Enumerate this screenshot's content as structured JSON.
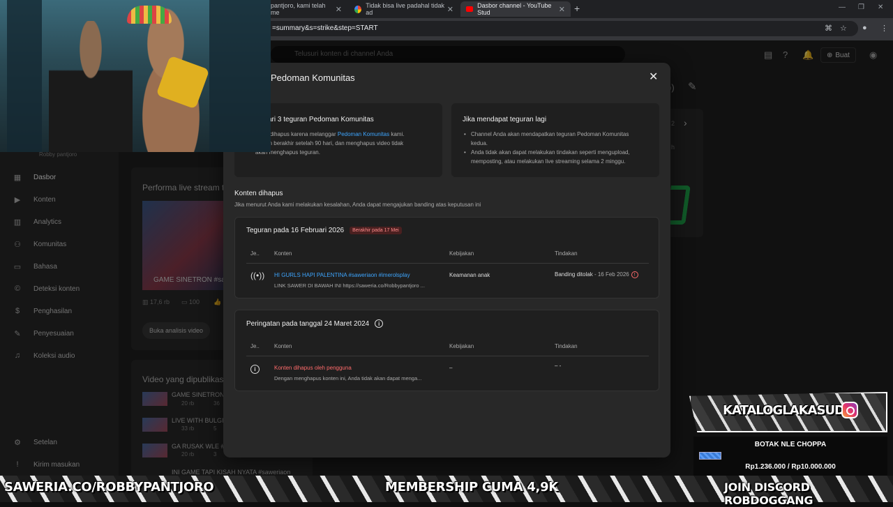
{
  "browser": {
    "tabs": [
      {
        "label": "pantjoro, kami telah me",
        "active": false
      },
      {
        "label": "Tidak bisa live padahal tidak ad",
        "active": false
      },
      {
        "label": "Dasbor channel - YouTube Stud",
        "active": true
      }
    ],
    "url": "=summary&s=strike&step=START"
  },
  "studio": {
    "search_placeholder": "Telusuri konten di channel Anda",
    "create_label": "Buat",
    "channel_name": "Robby pantjoro",
    "nav": [
      {
        "label": "Dasbor",
        "icon": "dashboard-icon",
        "active": true
      },
      {
        "label": "Konten",
        "icon": "content-icon"
      },
      {
        "label": "Analytics",
        "icon": "analytics-icon"
      },
      {
        "label": "Komunitas",
        "icon": "community-icon"
      },
      {
        "label": "Bahasa",
        "icon": "subtitles-icon"
      },
      {
        "label": "Deteksi konten",
        "icon": "copyright-icon"
      },
      {
        "label": "Penghasilan",
        "icon": "monetization-icon"
      },
      {
        "label": "Penyesuaian",
        "icon": "customization-icon"
      },
      {
        "label": "Koleksi audio",
        "icon": "audio-library-icon"
      }
    ],
    "nav_bottom": [
      {
        "label": "Setelan",
        "icon": "settings-icon"
      },
      {
        "label": "Kirim masukan",
        "icon": "feedback-icon"
      }
    ],
    "bg": {
      "live_perf_title": "Performa live stream t",
      "live_thumb_caption": "GAME SINETRON #sav",
      "stat_views": "17,6 rb",
      "stat_comments": "100",
      "analysis_button": "Buka analisis video",
      "published_title": "Video yang dipublikas",
      "published": [
        {
          "title": "GAME SINETRON #",
          "views": "20 rb",
          "extra": "36"
        },
        {
          "title": "LIVE WITH BULGIL",
          "views": "33 rb",
          "extra": "5"
        },
        {
          "title": "GA RUSAK WLE #sa",
          "views": "20 rb",
          "extra": "3"
        },
        {
          "title": "INI GAME TAPI KISAH NYATA #saweriaon",
          "views": "",
          "extra": ""
        }
      ],
      "pager": "2",
      "side_snip": "h"
    }
  },
  "modal": {
    "title": "Pedoman Komunitas",
    "card_left": {
      "title": "ari 3 teguran Pedoman Komunitas",
      "body_1": " Anda dihapus karena melanggar ",
      "body_link": "Pedoman Komunitas",
      "body_2": " kami.",
      "body_3": "n akan berakhir setelah 90 hari, dan menghapus video tidak",
      "body_4": "akan menghapus teguran."
    },
    "card_right": {
      "title": "Jika mendapat teguran lagi",
      "bullets": [
        "Channel Anda akan mendapatkan teguran Pedoman Komunitas kedua.",
        "Anda tidak akan dapat melakukan tindakan seperti mengupload, memposting, atau melakukan live streaming selama 2 minggu."
      ]
    },
    "removed": {
      "title": "Konten dihapus",
      "subtitle": "Jika menurut Anda kami melakukan kesalahan, Anda dapat mengajukan banding atas keputusan ini"
    },
    "strike": {
      "heading": "Teguran pada 16 Februari 2026",
      "expiry": "Berakhir pada 17 Mei",
      "columns": [
        "Je..",
        "Konten",
        "Kebijakan",
        "Tindakan"
      ],
      "row": {
        "title": "HI GURLS HAPI PALENTINA #saweriaon #imerolsplay",
        "subtitle": "LINK SAWER DI BAWAH INI https://saweria.co/Robbypantjoro ...",
        "policy": "Keamanan anak",
        "action": "Banding ditolak",
        "action_date": " - 16 Feb 2026"
      }
    },
    "warning": {
      "heading": "Peringatan pada tanggal 24 Maret 2024",
      "columns": [
        "Je..",
        "Konten",
        "Kebijakan",
        "Tindakan"
      ],
      "row": {
        "title": "Konten dihapus oleh pengguna",
        "subtitle": "Dengan menghapus konten ini, Anda tidak akan dapat menga...",
        "policy": "–",
        "action": "– -"
      }
    }
  },
  "stream_overlay": {
    "saweria": "SAWERIA.CO/ROBBYPANTJORO",
    "membership": "MEMBERSHIP CUMA 4,9K",
    "discord": "JOIN DISCORD ROBDOGGANG",
    "katalog": "KATALOGLAKASUD",
    "goal_title": "BOTAK NLE CHOPPA",
    "goal_amount": "Rp1.236.000 / Rp10.000.000",
    "goal_progress": 0.12
  }
}
